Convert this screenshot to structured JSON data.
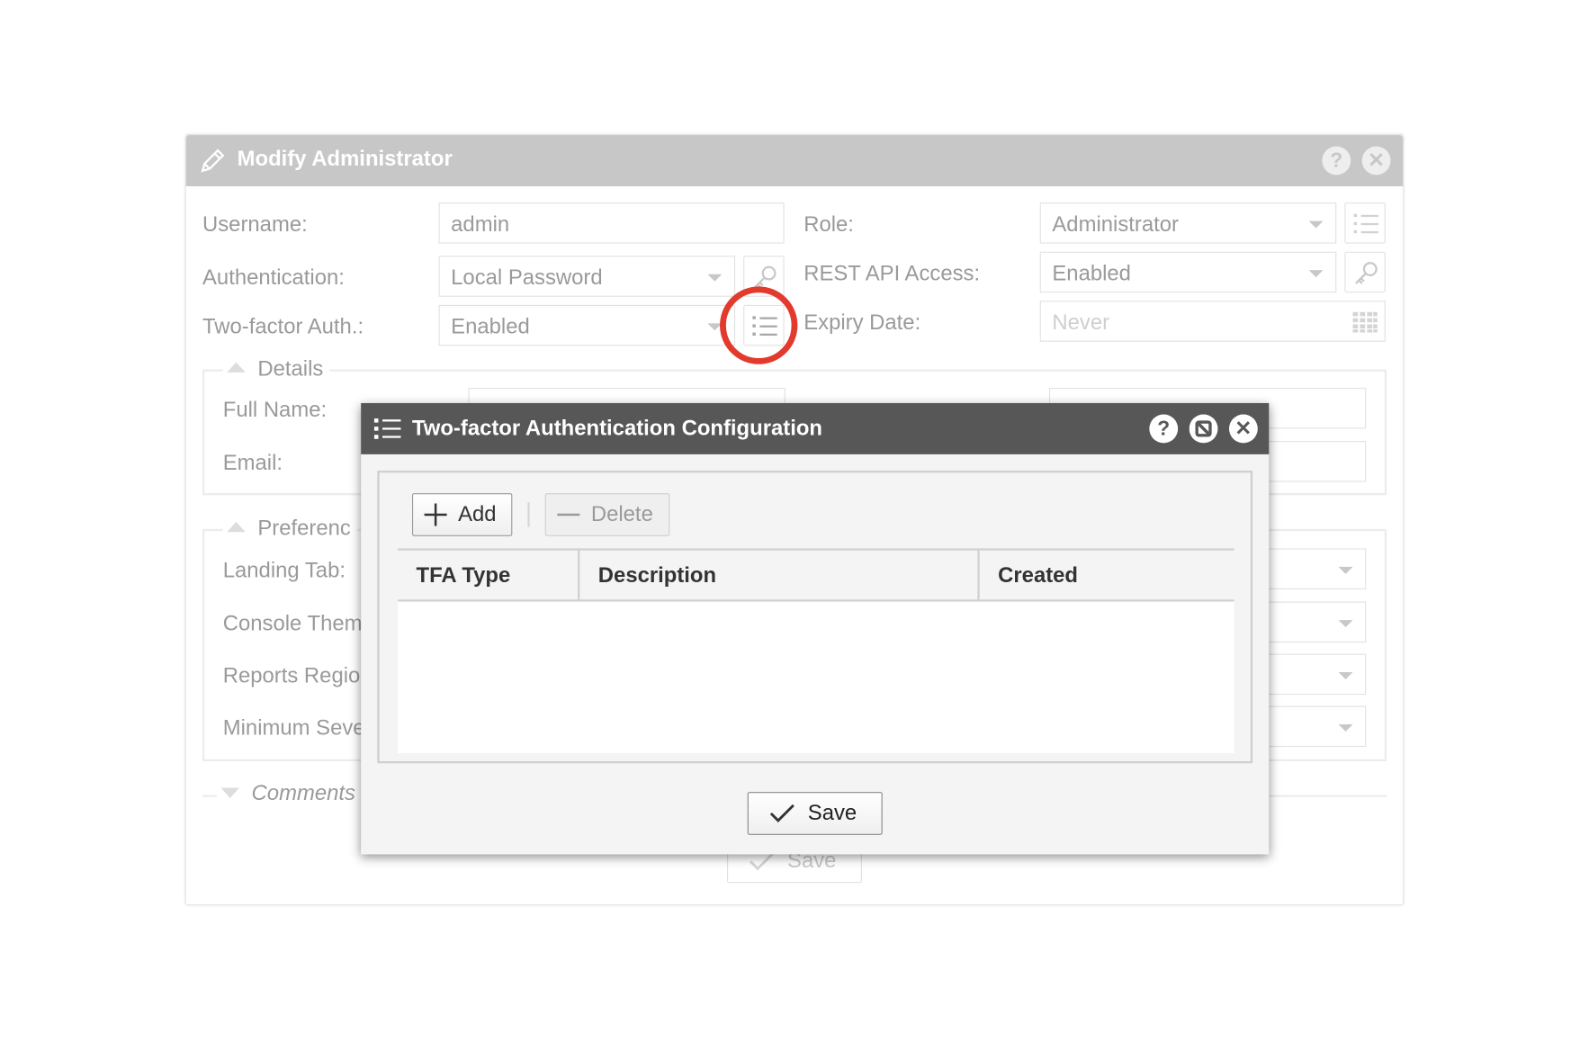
{
  "colors": {
    "main_titlebar": "#c7c7c7",
    "modal_titlebar": "#575757",
    "highlight": "#e23b2e"
  },
  "main_dialog": {
    "title": "Modify Administrator",
    "title_icon": "pencil-icon",
    "help_glyph": "?",
    "close_glyph": "✕",
    "fields": {
      "username_label": "Username:",
      "username_value": "admin",
      "authentication_label": "Authentication:",
      "authentication_value": "Local Password",
      "two_factor_label": "Two-factor Auth.:",
      "two_factor_value": "Enabled",
      "role_label": "Role:",
      "role_value": "Administrator",
      "rest_api_label": "REST API Access:",
      "rest_api_value": "Enabled",
      "expiry_label": "Expiry Date:",
      "expiry_placeholder": "Never"
    },
    "details": {
      "legend": "Details",
      "full_name_label": "Full Name:",
      "email_label": "Email:"
    },
    "preferences": {
      "legend": "Preferenc",
      "landing_tab_label": "Landing Tab:",
      "console_theme_label": "Console Them",
      "reports_region_label": "Reports Regio",
      "minimum_severity_label": "Minimum Seve"
    },
    "comments": {
      "legend": "Comments"
    },
    "save_label": "Save"
  },
  "tfa_dialog": {
    "title": "Two-factor Authentication Configuration",
    "title_icon": "list-icon",
    "help_glyph": "?",
    "close_glyph": "✕",
    "toolbar": {
      "add_label": "Add",
      "delete_label": "Delete"
    },
    "table": {
      "columns": [
        "TFA Type",
        "Description",
        "Created"
      ],
      "rows": []
    },
    "save_label": "Save"
  }
}
